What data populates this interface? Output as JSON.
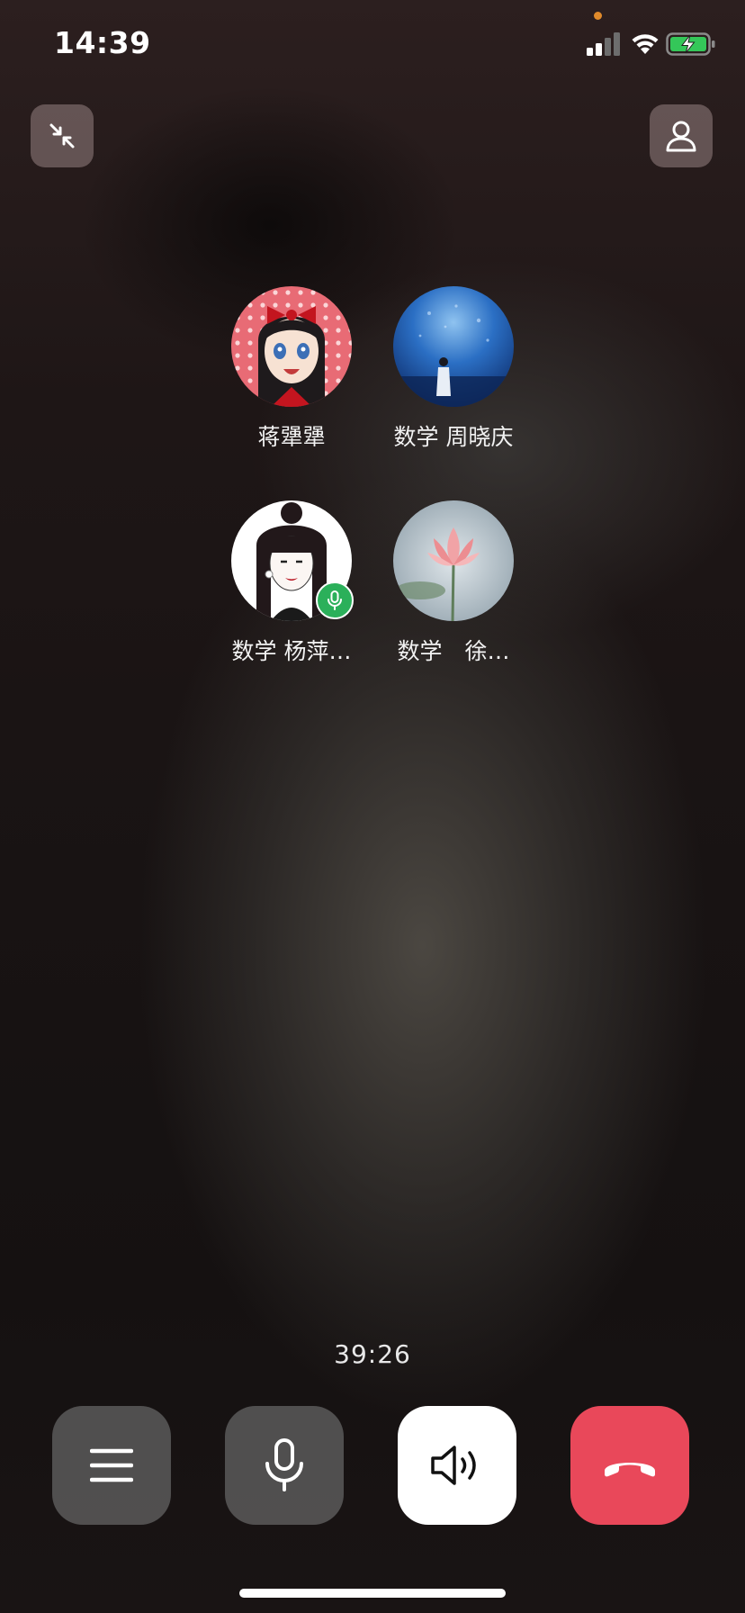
{
  "status_bar": {
    "time": "14:39",
    "signal_icon": "cellular-signal-icon",
    "wifi_icon": "wifi-icon",
    "battery_icon": "battery-charging-icon",
    "privacy_indicator_color": "#e08a2b"
  },
  "top_controls": {
    "minimize_icon": "minimize-arrows-icon",
    "add_member_icon": "person-icon"
  },
  "participants": [
    {
      "name": "蒋犟犟",
      "speaking": false
    },
    {
      "name": "数学 周晓庆",
      "speaking": false
    },
    {
      "name": "数学 杨萍…",
      "speaking": true
    },
    {
      "name": "数学　徐…",
      "speaking": false
    }
  ],
  "call": {
    "duration": "39:26"
  },
  "controls": {
    "menu_icon": "menu-icon",
    "mic_icon": "microphone-icon",
    "speaker_icon": "speaker-icon",
    "hangup_icon": "hang-up-icon"
  },
  "colors": {
    "hangup": "#e9485a",
    "speaking_badge": "#2bb05a",
    "speaker_active": "#ffffff"
  }
}
